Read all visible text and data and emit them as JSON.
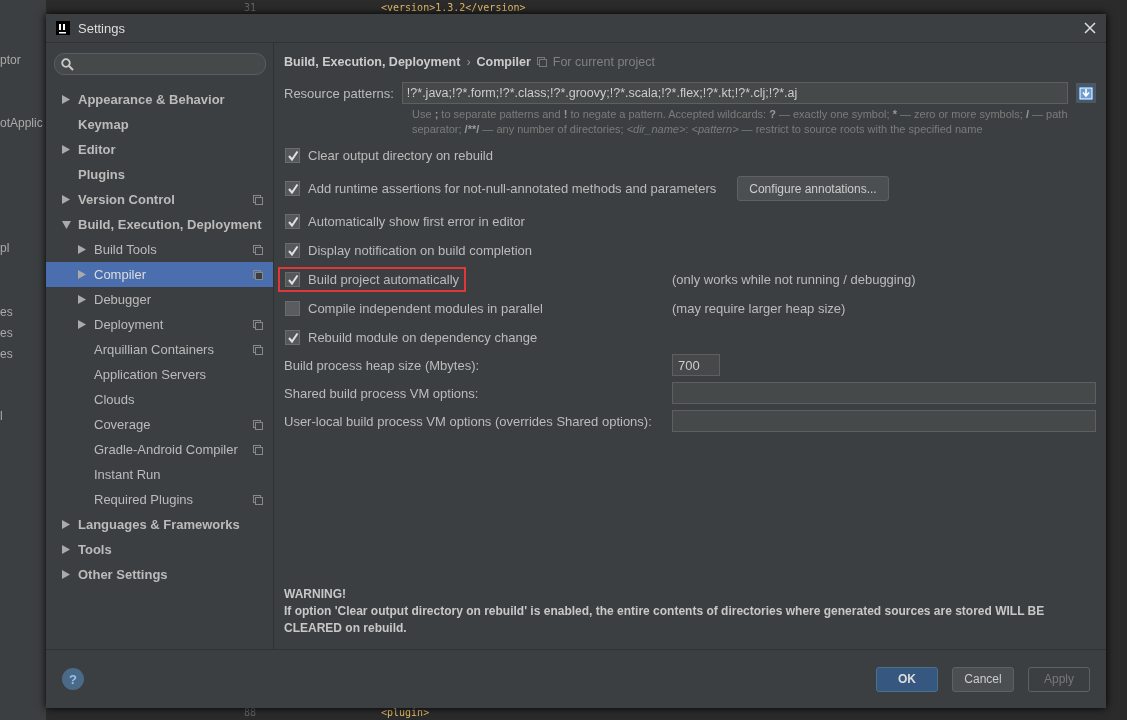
{
  "editor_background": {
    "left_fragments": [
      "ptor",
      "otApplic",
      "pl",
      "es",
      "es",
      "es",
      "l"
    ],
    "top_line": {
      "number": "31",
      "code": "<version>1.3.2</version>"
    },
    "bottom_line": {
      "number": "88",
      "code": "<plugin>"
    }
  },
  "window": {
    "title": "Settings"
  },
  "sidebar": {
    "items": [
      {
        "label": "Appearance & Behavior",
        "expandable": true,
        "expanded": false,
        "project_scoped": false,
        "selected": false
      },
      {
        "label": "Keymap",
        "expandable": false,
        "expanded": false,
        "project_scoped": false,
        "selected": false
      },
      {
        "label": "Editor",
        "expandable": true,
        "expanded": false,
        "project_scoped": false,
        "selected": false
      },
      {
        "label": "Plugins",
        "expandable": false,
        "expanded": false,
        "project_scoped": false,
        "selected": false
      },
      {
        "label": "Version Control",
        "expandable": true,
        "expanded": false,
        "project_scoped": true,
        "selected": false
      },
      {
        "label": "Build, Execution, Deployment",
        "expandable": true,
        "expanded": true,
        "project_scoped": false,
        "selected": false,
        "children": [
          {
            "label": "Build Tools",
            "expandable": true,
            "expanded": false,
            "project_scoped": true,
            "selected": false
          },
          {
            "label": "Compiler",
            "expandable": true,
            "expanded": false,
            "project_scoped": true,
            "selected": true
          },
          {
            "label": "Debugger",
            "expandable": true,
            "expanded": false,
            "project_scoped": false,
            "selected": false
          },
          {
            "label": "Deployment",
            "expandable": true,
            "expanded": false,
            "project_scoped": true,
            "selected": false
          },
          {
            "label": "Arquillian Containers",
            "expandable": false,
            "expanded": false,
            "project_scoped": true,
            "selected": false
          },
          {
            "label": "Application Servers",
            "expandable": false,
            "expanded": false,
            "project_scoped": false,
            "selected": false
          },
          {
            "label": "Clouds",
            "expandable": false,
            "expanded": false,
            "project_scoped": false,
            "selected": false
          },
          {
            "label": "Coverage",
            "expandable": false,
            "expanded": false,
            "project_scoped": true,
            "selected": false
          },
          {
            "label": "Gradle-Android Compiler",
            "expandable": false,
            "expanded": false,
            "project_scoped": true,
            "selected": false
          },
          {
            "label": "Instant Run",
            "expandable": false,
            "expanded": false,
            "project_scoped": false,
            "selected": false
          },
          {
            "label": "Required Plugins",
            "expandable": false,
            "expanded": false,
            "project_scoped": true,
            "selected": false
          }
        ]
      },
      {
        "label": "Languages & Frameworks",
        "expandable": true,
        "expanded": false,
        "project_scoped": false,
        "selected": false
      },
      {
        "label": "Tools",
        "expandable": true,
        "expanded": false,
        "project_scoped": false,
        "selected": false
      },
      {
        "label": "Other Settings",
        "expandable": true,
        "expanded": false,
        "project_scoped": false,
        "selected": false
      }
    ]
  },
  "breadcrumb": {
    "parent": "Build, Execution, Deployment",
    "separator": "›",
    "current": "Compiler",
    "scope": "For current project"
  },
  "resource_patterns": {
    "label": "Resource patterns:",
    "value": "!?*.java;!?*.form;!?*.class;!?*.groovy;!?*.scala;!?*.flex;!?*.kt;!?*.clj;!?*.aj",
    "hint": [
      {
        "kind": "plain",
        "text": "Use "
      },
      {
        "kind": "bold",
        "text": ";"
      },
      {
        "kind": "plain",
        "text": " to separate patterns and "
      },
      {
        "kind": "bold",
        "text": "!"
      },
      {
        "kind": "plain",
        "text": " to negate a pattern. Accepted wildcards: "
      },
      {
        "kind": "bold",
        "text": "?"
      },
      {
        "kind": "plain",
        "text": " — exactly one symbol; "
      },
      {
        "kind": "bold",
        "text": "*"
      },
      {
        "kind": "plain",
        "text": " — zero or more symbols; "
      },
      {
        "kind": "bold",
        "text": "/"
      },
      {
        "kind": "plain",
        "text": " — path separator; "
      },
      {
        "kind": "bold",
        "text": "/**/"
      },
      {
        "kind": "plain",
        "text": " — any number of directories; "
      },
      {
        "kind": "italic",
        "text": "<dir_name>"
      },
      {
        "kind": "plain",
        "text": ": "
      },
      {
        "kind": "italic",
        "text": "<pattern>"
      },
      {
        "kind": "plain",
        "text": " — restrict to source roots with the specified name"
      }
    ]
  },
  "options": [
    {
      "label": "Clear output directory on rebuild",
      "checked": true,
      "highlighted": false
    },
    {
      "label": "Add runtime assertions for not-null-annotated methods and parameters",
      "checked": true,
      "highlighted": false,
      "button": "Configure annotations..."
    },
    {
      "label": "Automatically show first error in editor",
      "checked": true,
      "highlighted": false
    },
    {
      "label": "Display notification on build completion",
      "checked": true,
      "highlighted": false
    },
    {
      "label": "Build project automatically",
      "checked": true,
      "highlighted": true,
      "note": "(only works while not running / debugging)"
    },
    {
      "label": "Compile independent modules in parallel",
      "checked": false,
      "highlighted": false,
      "note": "(may require larger heap size)"
    },
    {
      "label": "Rebuild module on dependency change",
      "checked": true,
      "highlighted": false
    }
  ],
  "fields": [
    {
      "kind": "short",
      "label": "Build process heap size (Mbytes):",
      "value": "700"
    },
    {
      "kind": "wide",
      "label": "Shared build process VM options:"
    },
    {
      "kind": "wide",
      "label": "User-local build process VM options (overrides Shared options):"
    }
  ],
  "warning": {
    "title": "WARNING!",
    "text": "If option 'Clear output directory on rebuild' is enabled, the entire contents of directories where generated sources are stored WILL BE CLEARED on rebuild."
  },
  "buttons": [
    {
      "label": "OK",
      "kind": "default",
      "disabled": false
    },
    {
      "label": "Cancel",
      "kind": "normal",
      "disabled": false
    },
    {
      "label": "Apply",
      "kind": "normal",
      "disabled": true
    }
  ],
  "help": "?"
}
